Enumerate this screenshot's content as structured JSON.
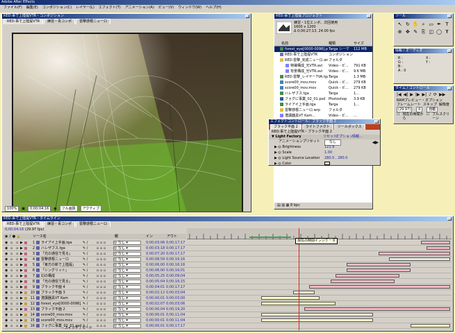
{
  "app": {
    "title": "Adobe After Effects",
    "menu": [
      "ファイル(F)",
      "編集(E)",
      "コンポジション(C)",
      "レイヤー(L)",
      "エフェクト(T)",
      "アニメーション(A)",
      "ビュー(V)",
      "ウィンドウ(W)",
      "ヘルプ(H)"
    ]
  },
  "comp_window": {
    "title": "RED:事で上陸提VTR・コンポジション",
    "tabs": [
      "RED:事で上陸提VTR",
      "練習・青コンポ",
      "雷撃感根ニューロ"
    ],
    "zoom": "100%",
    "timecode": "0;00;04;16",
    "resolution": "フル画質",
    "view": "アクティブ",
    "colors": {
      "bg": "#d4d0c8",
      "frame_border": "#1a1a1a"
    }
  },
  "project_window": {
    "title": "RED:事で上陸提プロジェクト",
    "info_name": "練習・1位エンポ、次回使用",
    "info_size": "1600 x 1200",
    "info_dur": "Δ 0;00;27;13, 24.00 fps",
    "columns": [
      "名前",
      "種類",
      "サイズ"
    ],
    "items": [
      {
        "name": "forest_eye[0000-0098].psa",
        "type": "Targa シーケ",
        "size": "112 MB"
      },
      {
        "name": "RED:事で上陸提VTR",
        "type": "コンポジション",
        "size": ""
      },
      {
        "name": "RED:雷撃_完成ニューロ.wrp",
        "type": "フォルダ",
        "size": ""
      },
      {
        "name": "特撮構成_光VTR.avi",
        "type": "Video - ビ...",
        "size": "791 KB"
      },
      {
        "name": "背景構成_光VTR.avi",
        "type": "Video - ビ...",
        "size": "9.6 MB"
      },
      {
        "name": "RED:雷撃_レイヤー7VA.tga",
        "type": "Targa",
        "size": "1.3 MB"
      },
      {
        "name": "score00_mov.mov",
        "type": "Quick - ビ...",
        "size": "279 KB"
      },
      {
        "name": "score00_mov.mov",
        "type": "Quick - ビ...",
        "size": "279 KB"
      },
      {
        "name": "ハレザブス.tga",
        "type": "Targa",
        "size": "1..."
      },
      {
        "name": "フォグに事業_02_01.psd",
        "type": "Photoshop",
        "size": "3.9 KB"
      },
      {
        "name": "ライアイ上手画.tga",
        "type": "Targa",
        "size": "1..."
      },
      {
        "name": "雷撃感根ニューロ.wrp",
        "type": "フォルダ",
        "size": ""
      },
      {
        "name": "潜講器具VT Kam...",
        "type": "Video - ビ...",
        "size": "..."
      }
    ],
    "footer": "8 bpc"
  },
  "effects_window": {
    "title": "エフェクトコントロール：ブラック平面 2",
    "tabs": [
      "ブラック平面 2",
      "ライトファクト",
      "ツールボックス"
    ],
    "subtitle": "RED:事で上陸提VTR・ブラック平面 2",
    "effect_name": "Light Factory",
    "effect_links": [
      "リセット",
      "オプション",
      "情報..."
    ],
    "preset_label": "アニメーションプリセット",
    "preset_value": "なし",
    "props": [
      {
        "name": "Brightness",
        "value": "121.9"
      },
      {
        "name": "Scale",
        "value": "1.00"
      },
      {
        "name": "Light Source Location",
        "value": "280.0 , 280.0"
      },
      {
        "name": "Color",
        "value": ""
      }
    ]
  },
  "tools_window": {
    "title": "ツール"
  },
  "info_window": {
    "title": "情報 / オーディオ",
    "lines": [
      "R :",
      "G :",
      "B :",
      "A : 0",
      "X :",
      "Y :"
    ]
  },
  "ram_window": {
    "title": "タイム / コントロール",
    "label": "RAMプレビュー・オプション",
    "frame_rate_label": "フレームレート",
    "skip_label": "スキップ",
    "res_label": "解像度",
    "frame_rate": "(29.97)",
    "skip": "0",
    "res": "自動",
    "from_current": "現在の時間から",
    "fullscreen": "フルスクリーン"
  },
  "timeline": {
    "title": "RED:事で上陸提VTR・タイムライン",
    "tabs": [
      "RED:事で上陸提VTR",
      "練習・青コンポ",
      "雷撃感根ニューロ"
    ],
    "timecode": "0;00;04;16",
    "fps": "(29.97 fps)",
    "col_source": "ソース名",
    "col_parent": "親",
    "col_in": "イン",
    "col_out": "アウト",
    "tooltip": "現在の時間インジケータ",
    "footer_switch": "スイッチ / モード",
    "layers": [
      {
        "n": "1",
        "name": "ライアイ上手画.tga",
        "in": "0;00;03;06",
        "out": "0;00;17;17",
        "bar_s": 0.88,
        "bar_e": 0.99,
        "col": "#f4b8c4"
      },
      {
        "n": "2",
        "name": "ハレザブス.tga",
        "in": "0;00;03;18",
        "out": "0;00;17;17",
        "bar_s": 0.9,
        "bar_e": 0.99,
        "col": "#f4b8c4"
      },
      {
        "n": "3",
        "name": "「光の通信で見る」",
        "in": "0;00;07;20",
        "out": "0;00;17;17",
        "bar_s": 0.72,
        "bar_e": 0.99,
        "col": "#f4b8c4"
      },
      {
        "n": "4",
        "name": "雷撃感根ニューロ",
        "in": "0;00;08;59",
        "out": "0;00;16;16",
        "bar_s": 0.76,
        "bar_e": 0.99,
        "col": "#e8e8e8"
      },
      {
        "n": "5",
        "name": "「東方の新で上陸提」",
        "in": "0;00;06;00",
        "out": "0;00;16;16",
        "bar_s": 0.6,
        "bar_e": 0.84,
        "col": "#f4b8c4"
      },
      {
        "n": "6",
        "name": "「シングリット」",
        "in": "0;00;06;00",
        "out": "0;00;16;01",
        "bar_s": 0.6,
        "bar_e": 0.84,
        "col": "#f4b8c4"
      },
      {
        "n": "7",
        "name": "幻の構成",
        "in": "0;00;05;25",
        "out": "0;00;09;04",
        "bar_s": 0.56,
        "bar_e": 0.8,
        "col": "#f4b8c4"
      },
      {
        "n": "8",
        "name": "「光の通信で見る」",
        "in": "0;00;05;04",
        "out": "0;00;16;15",
        "bar_s": 0.54,
        "bar_e": 0.78,
        "col": "#f4b8c4"
      },
      {
        "n": "9",
        "name": "ブラック平面 4",
        "in": "0;00;04;01",
        "out": "0;00;17;17",
        "bar_s": 0.46,
        "bar_e": 0.99,
        "col": "#f4b8c4"
      },
      {
        "n": "10",
        "name": "ブラック平面 3",
        "in": "0;00;02;12",
        "out": "0;00;03;04",
        "bar_s": 0.4,
        "bar_e": 0.48,
        "col": "#ffffc8"
      },
      {
        "n": "11",
        "name": "潜講器具VT Kam",
        "in": "0;00;00;01",
        "out": "0;00;03;00",
        "bar_s": 0.28,
        "bar_e": 0.5,
        "col": "#ffffc8"
      },
      {
        "n": "12",
        "name": "forest_eye[0000-0098].psa",
        "in": "0;00;02;07",
        "out": "0;00;03;06",
        "bar_s": 0.28,
        "bar_e": 0.56,
        "col": "#ffffc8"
      },
      {
        "n": "13",
        "name": "ブラック平面 2",
        "in": "0;00;00;04",
        "out": "0;00;19;20",
        "bar_s": 0.44,
        "bar_e": 0.99,
        "col": "#f4b8c4"
      },
      {
        "n": "14",
        "name": "score00_mov.mov",
        "in": "0;00;00;01",
        "out": "0;00;11;04",
        "bar_s": 0.28,
        "bar_e": 0.7,
        "col": "#ffffc8"
      },
      {
        "n": "15",
        "name": "score00_mov.mov",
        "in": "0;00;00;01",
        "out": "0;00;11;04",
        "bar_s": 0.28,
        "bar_e": 0.7,
        "col": "#ffffc8"
      },
      {
        "n": "16",
        "name": "フォグに事業_02_01.psd",
        "in": "0;00;00;01",
        "out": "0;00;17;17",
        "bar_s": 0.84,
        "bar_e": 0.99,
        "col": "#ffffc8"
      }
    ]
  }
}
